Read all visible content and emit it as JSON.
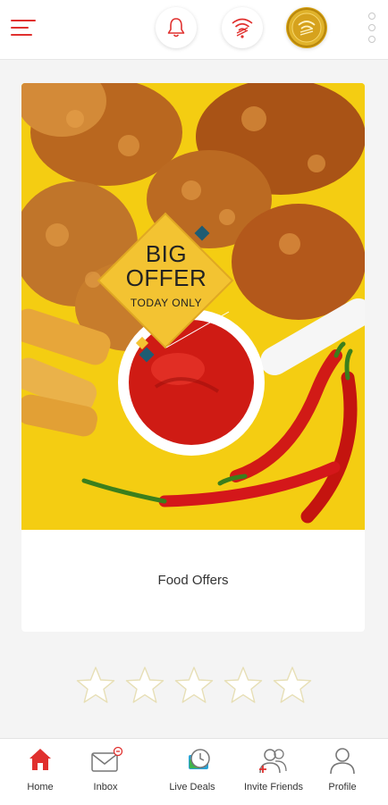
{
  "colors": {
    "accent": "#e0302e",
    "banner_yellow": "#f4cd12",
    "offer_gold": "#f3c332",
    "teal": "#1e5c73"
  },
  "topbar": {
    "menu_icon": "hamburger-icon",
    "actions": [
      {
        "name": "notifications",
        "icon": "bell-icon"
      },
      {
        "name": "wifi-offers",
        "icon": "wifi-icon"
      },
      {
        "name": "coins",
        "icon": "coin-wifi-icon"
      }
    ],
    "overflow_icon": "kebab-icon"
  },
  "offer_card": {
    "badge_line1": "BIG",
    "badge_line2": "OFFER",
    "badge_line3": "TODAY ONLY",
    "title": "Food Offers"
  },
  "rating": {
    "max": 5,
    "value": 0
  },
  "bottom_nav": {
    "items": [
      {
        "label": "Home",
        "icon": "home-icon",
        "active": true
      },
      {
        "label": "Inbox",
        "icon": "inbox-icon",
        "active": false
      },
      {
        "label": "Live Deals",
        "icon": "live-deals-icon",
        "active": false
      },
      {
        "label": "Invite Friends",
        "icon": "invite-friends-icon",
        "active": false
      },
      {
        "label": "Profile",
        "icon": "profile-icon",
        "active": false
      }
    ]
  }
}
